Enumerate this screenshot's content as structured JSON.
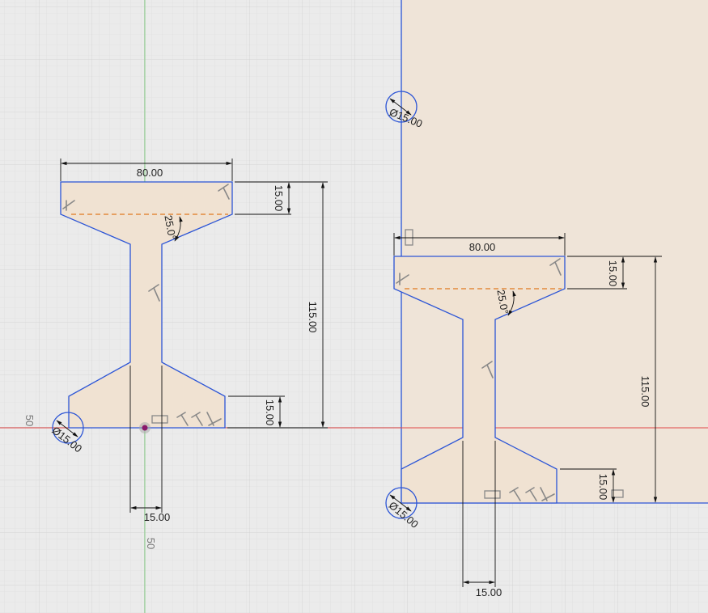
{
  "sketch": {
    "left_section": {
      "dim_top_width": "80.00",
      "dim_flange_top": "15.00",
      "dim_angle": "25.0°",
      "dim_height": "115.00",
      "dim_flange_bottom": "15.00",
      "dim_web": "15.00",
      "dim_hole": "Ø15.00"
    },
    "right_section": {
      "dim_top_width": "80.00",
      "dim_flange_top": "15.00",
      "dim_angle": "25.0°",
      "dim_height": "115.00",
      "dim_flange_bottom": "15.00",
      "dim_web": "15.00",
      "dim_hole_top": "Ø15.00",
      "dim_hole_bottom": "Ø15.00"
    },
    "axis_labels": {
      "x_marker": "50",
      "y_marker": "50"
    }
  },
  "colors": {
    "background": "#ebebeb",
    "grid_minor": "#dddddd",
    "grid_major": "#d0d0d0",
    "profile_fill": "#f0e2d2",
    "profile_stroke": "#2c55d6",
    "x_axis": "#e04848",
    "y_axis": "#7fcf7f"
  }
}
